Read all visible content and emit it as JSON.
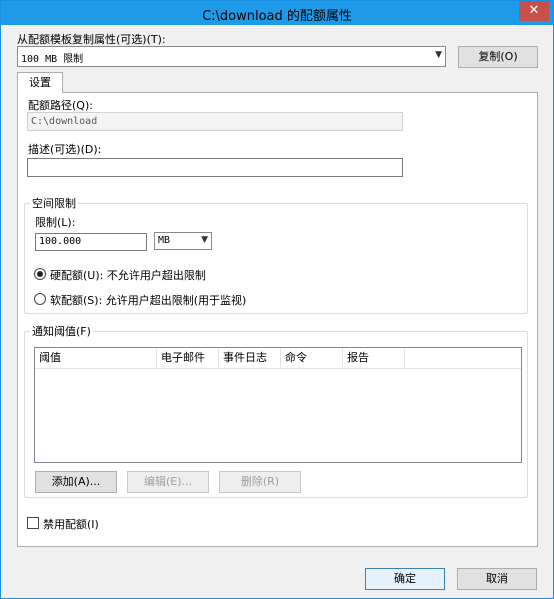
{
  "window": {
    "title": "C:\\download 的配额属性",
    "close_glyph": "✕"
  },
  "template": {
    "label": "从配额模板复制属性(可选)(T):",
    "selected": "100 MB 限制",
    "copy_button": "复制(O)"
  },
  "tabs": [
    {
      "label": "设置"
    }
  ],
  "settings": {
    "quota_path_label": "配额路径(Q):",
    "quota_path_value": "C:\\download",
    "description_label": "描述(可选)(D):",
    "description_value": ""
  },
  "space_limit": {
    "group_title": "空间限制",
    "limit_label": "限制(L):",
    "limit_value": "100.000",
    "unit": "MB",
    "hard_quota": "硬配额(U): 不允许用户超出限制",
    "soft_quota": "软配额(S): 允许用户超出限制(用于监视)",
    "selected": "hard"
  },
  "thresholds": {
    "group_title": "通知阈值(F)",
    "columns": [
      "阈值",
      "电子邮件",
      "事件日志",
      "命令",
      "报告"
    ],
    "rows": [],
    "add_button": "添加(A)...",
    "edit_button": "编辑(E)...",
    "delete_button": "删除(R)"
  },
  "disable_quota": {
    "label": "禁用配额(I)",
    "checked": false
  },
  "footer": {
    "ok_button": "确定",
    "cancel_button": "取消"
  }
}
